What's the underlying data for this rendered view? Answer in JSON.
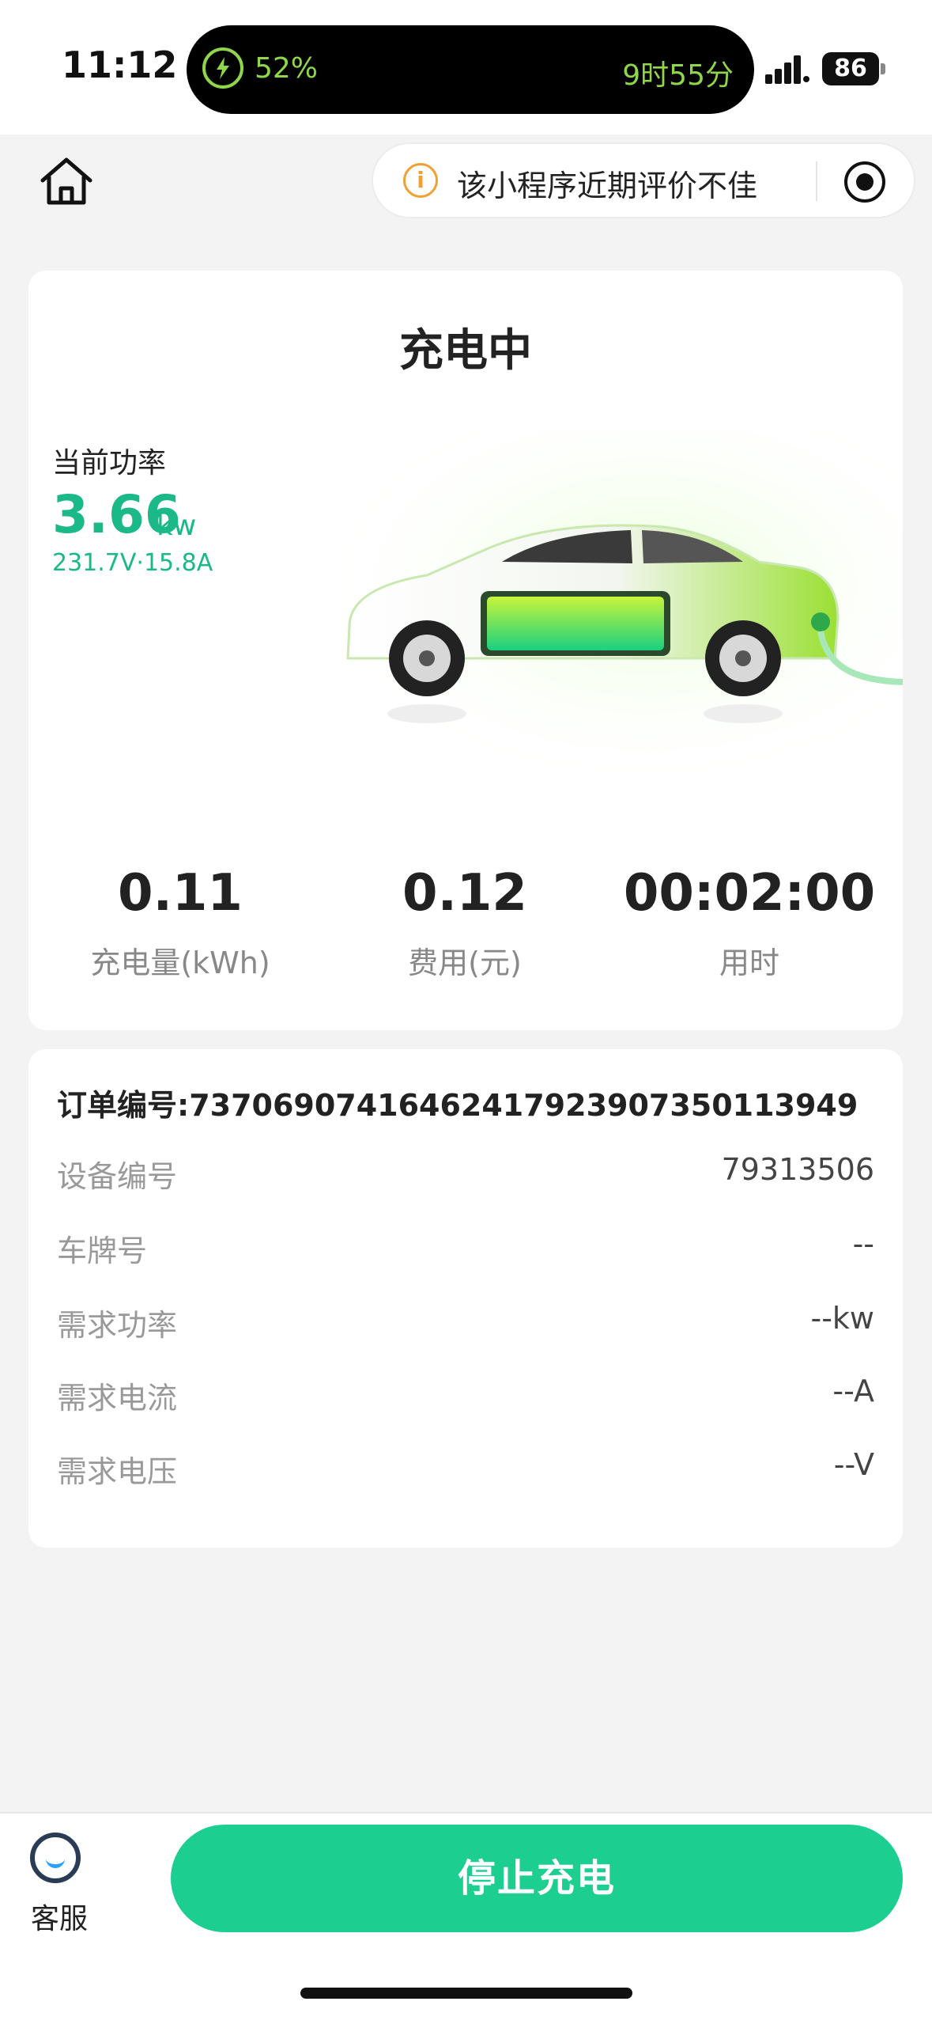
{
  "status_bar": {
    "time": "11:12",
    "charge_percent": "52%",
    "remaining": "9时55分",
    "battery": "86"
  },
  "nav": {
    "warning_text": "该小程序近期评价不佳",
    "icons": [
      "home-icon",
      "info-icon",
      "target-icon"
    ]
  },
  "charging": {
    "status_title": "充电中",
    "power_label": "当前功率",
    "power_value": "3.66",
    "power_unit": "kw",
    "power_detail": "231.7V·15.8A",
    "stats": [
      {
        "value": "0.11",
        "label": "充电量(kWh)"
      },
      {
        "value": "0.12",
        "label": "费用(元)"
      },
      {
        "value": "00:02:00",
        "label": "用时"
      }
    ]
  },
  "order": {
    "order_number": "订单编号:73706907416462417923907350113949",
    "rows": [
      {
        "key": "设备编号",
        "value": "79313506"
      },
      {
        "key": "车牌号",
        "value": "--"
      },
      {
        "key": "需求功率",
        "value": "--kw"
      },
      {
        "key": "需求电流",
        "value": "--A"
      },
      {
        "key": "需求电压",
        "value": "--V"
      }
    ]
  },
  "bottom": {
    "service_label": "客服",
    "stop_button": "停止充电"
  },
  "colors": {
    "accent": "#1bb888",
    "button": "#1ccf90",
    "battery_green": "#8fd64a",
    "warning": "#f0a030"
  }
}
